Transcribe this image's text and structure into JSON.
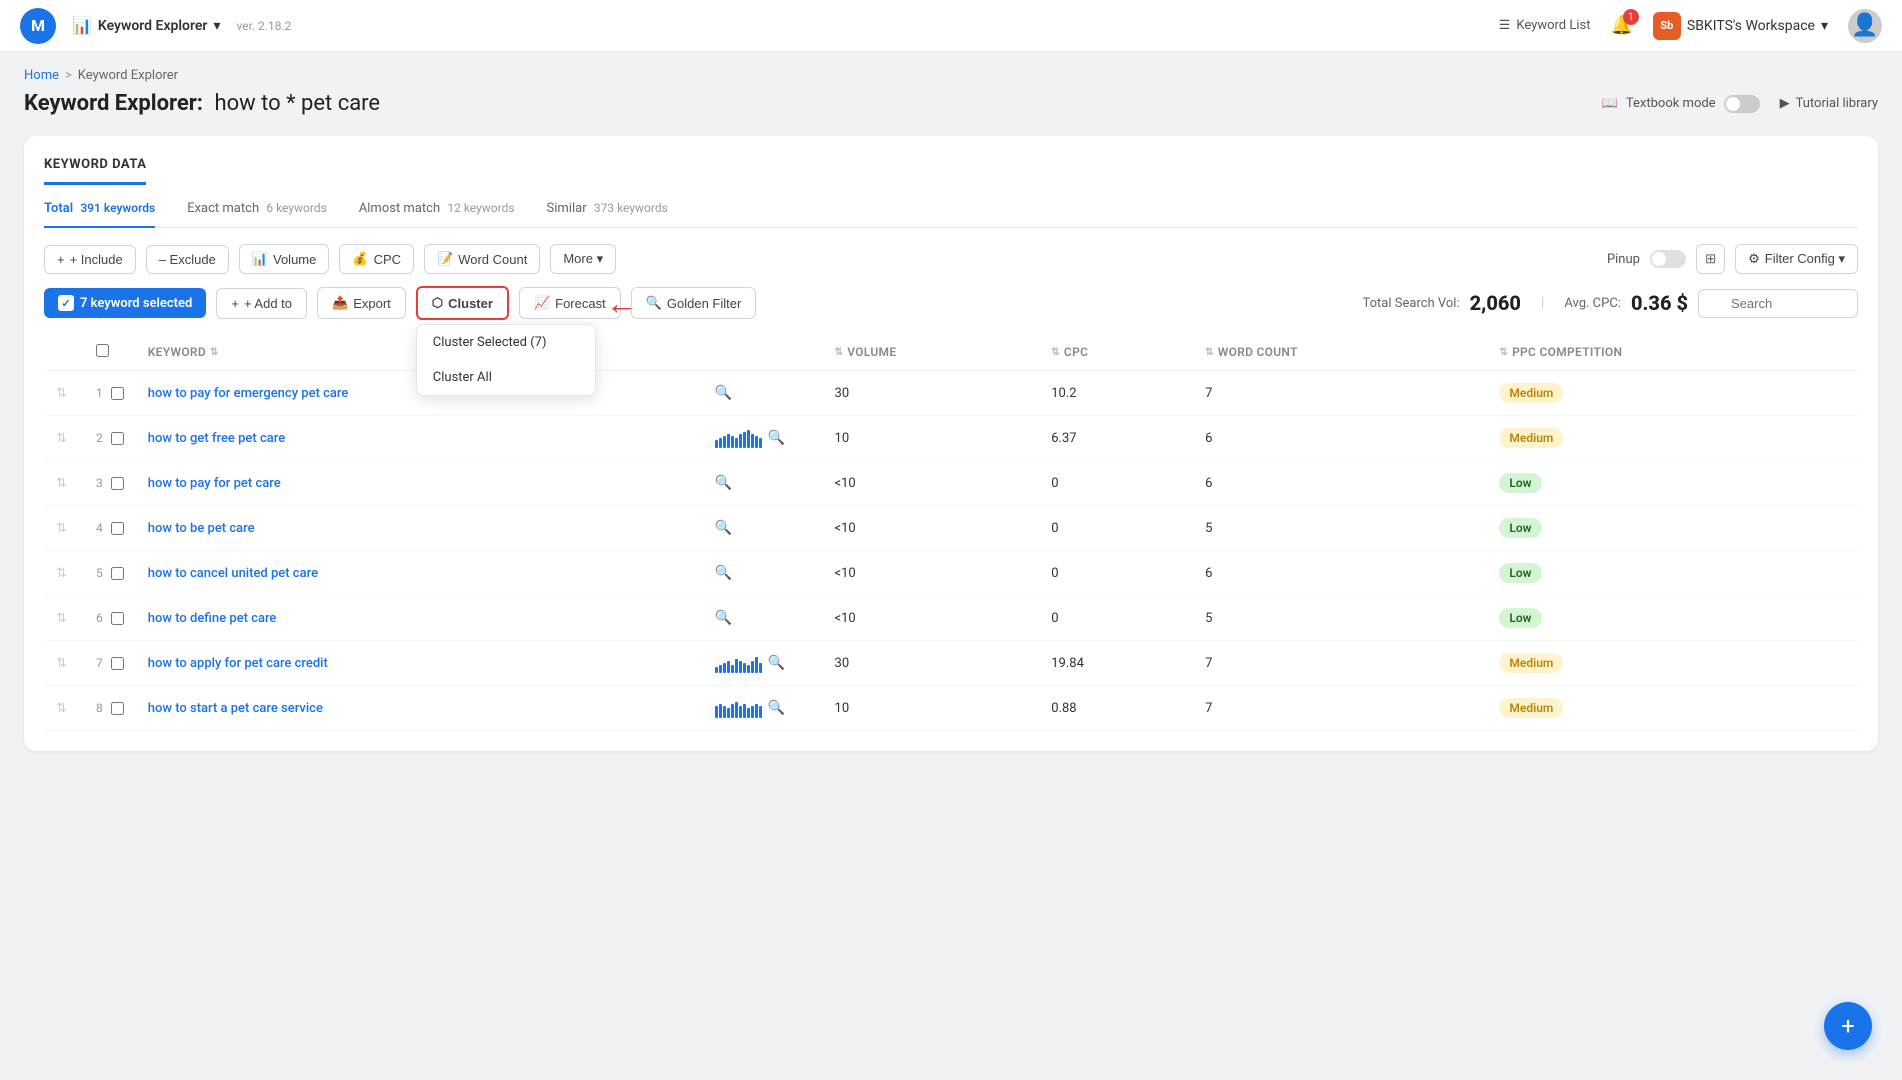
{
  "app": {
    "logo_letter": "M",
    "name": "Keyword Explorer",
    "version": "ver. 2.18.2",
    "chevron": "▾"
  },
  "topnav": {
    "keyword_list_label": "Keyword List",
    "notification_count": "1",
    "workspace_label": "SBKITS's Workspace",
    "workspace_icon": "Sb"
  },
  "breadcrumb": {
    "home": "Home",
    "sep": ">",
    "current": "Keyword Explorer"
  },
  "page_title": {
    "prefix": "Keyword Explorer:",
    "query": "how to * pet care"
  },
  "page_actions": {
    "textbook_mode": "Textbook mode",
    "tutorial_library": "Tutorial library"
  },
  "card": {
    "title": "KEYWORD DATA"
  },
  "tabs": [
    {
      "label": "Total",
      "count": "391 keywords",
      "active": true
    },
    {
      "label": "Exact match",
      "count": "6 keywords",
      "active": false
    },
    {
      "label": "Almost match",
      "count": "12 keywords",
      "active": false
    },
    {
      "label": "Similar",
      "count": "373 keywords",
      "active": false
    }
  ],
  "filters": {
    "include": "+ Include",
    "exclude": "– Exclude",
    "volume": "Volume",
    "cpc": "CPC",
    "word_count": "Word Count",
    "more": "More ▾",
    "pinup": "Pinup",
    "filter_config": "⚙ Filter Config ▾"
  },
  "action_bar": {
    "selected_label": "7 keyword selected",
    "add_to": "+ Add to",
    "export": "Export",
    "cluster": "Cluster",
    "forecast": "Forecast",
    "golden_filter": "Golden Filter",
    "total_search_vol_label": "Total Search Vol:",
    "total_search_vol_value": "2,060",
    "avg_cpc_label": "Avg. CPC:",
    "avg_cpc_value": "0.36 $",
    "search_placeholder": "Search"
  },
  "cluster_dropdown": {
    "item1": "Cluster Selected (7)",
    "item2": "Cluster All"
  },
  "table": {
    "headers": [
      "",
      "",
      "KEYWORD",
      "",
      "VOLUME",
      "CPC",
      "WORD COUNT",
      "PPC COMPETITION"
    ],
    "rows": [
      {
        "num": 1,
        "keyword": "how to pay for emergency pet care",
        "has_chart": false,
        "volume": "30",
        "cpc": "10.2",
        "word_count": "7",
        "competition": "Medium",
        "comp_type": "medium"
      },
      {
        "num": 2,
        "keyword": "how to get free pet care",
        "has_chart": true,
        "chart_bars": [
          8,
          10,
          12,
          14,
          12,
          10,
          14,
          16,
          18,
          14,
          12,
          10
        ],
        "volume": "10",
        "cpc": "6.37",
        "word_count": "6",
        "competition": "Medium",
        "comp_type": "medium"
      },
      {
        "num": 3,
        "keyword": "how to pay for pet care",
        "has_chart": false,
        "volume": "<10",
        "cpc": "0",
        "word_count": "6",
        "competition": "Low",
        "comp_type": "low"
      },
      {
        "num": 4,
        "keyword": "how to be pet care",
        "has_chart": false,
        "volume": "<10",
        "cpc": "0",
        "word_count": "5",
        "competition": "Low",
        "comp_type": "low"
      },
      {
        "num": 5,
        "keyword": "how to cancel united pet care",
        "has_chart": false,
        "volume": "<10",
        "cpc": "0",
        "word_count": "6",
        "competition": "Low",
        "comp_type": "low"
      },
      {
        "num": 6,
        "keyword": "how to define pet care",
        "has_chart": false,
        "volume": "<10",
        "cpc": "0",
        "word_count": "5",
        "competition": "Low",
        "comp_type": "low"
      },
      {
        "num": 7,
        "keyword": "how to apply for pet care credit",
        "has_chart": true,
        "chart_bars": [
          6,
          8,
          10,
          12,
          8,
          14,
          12,
          10,
          8,
          12,
          16,
          10
        ],
        "volume": "30",
        "cpc": "19.84",
        "word_count": "7",
        "competition": "Medium",
        "comp_type": "medium"
      },
      {
        "num": 8,
        "keyword": "how to start a pet care service",
        "has_chart": true,
        "chart_bars": [
          12,
          14,
          12,
          10,
          14,
          16,
          12,
          14,
          10,
          12,
          14,
          12
        ],
        "volume": "10",
        "cpc": "0.88",
        "word_count": "7",
        "competition": "Medium",
        "comp_type": "medium"
      }
    ]
  },
  "fab": "+"
}
